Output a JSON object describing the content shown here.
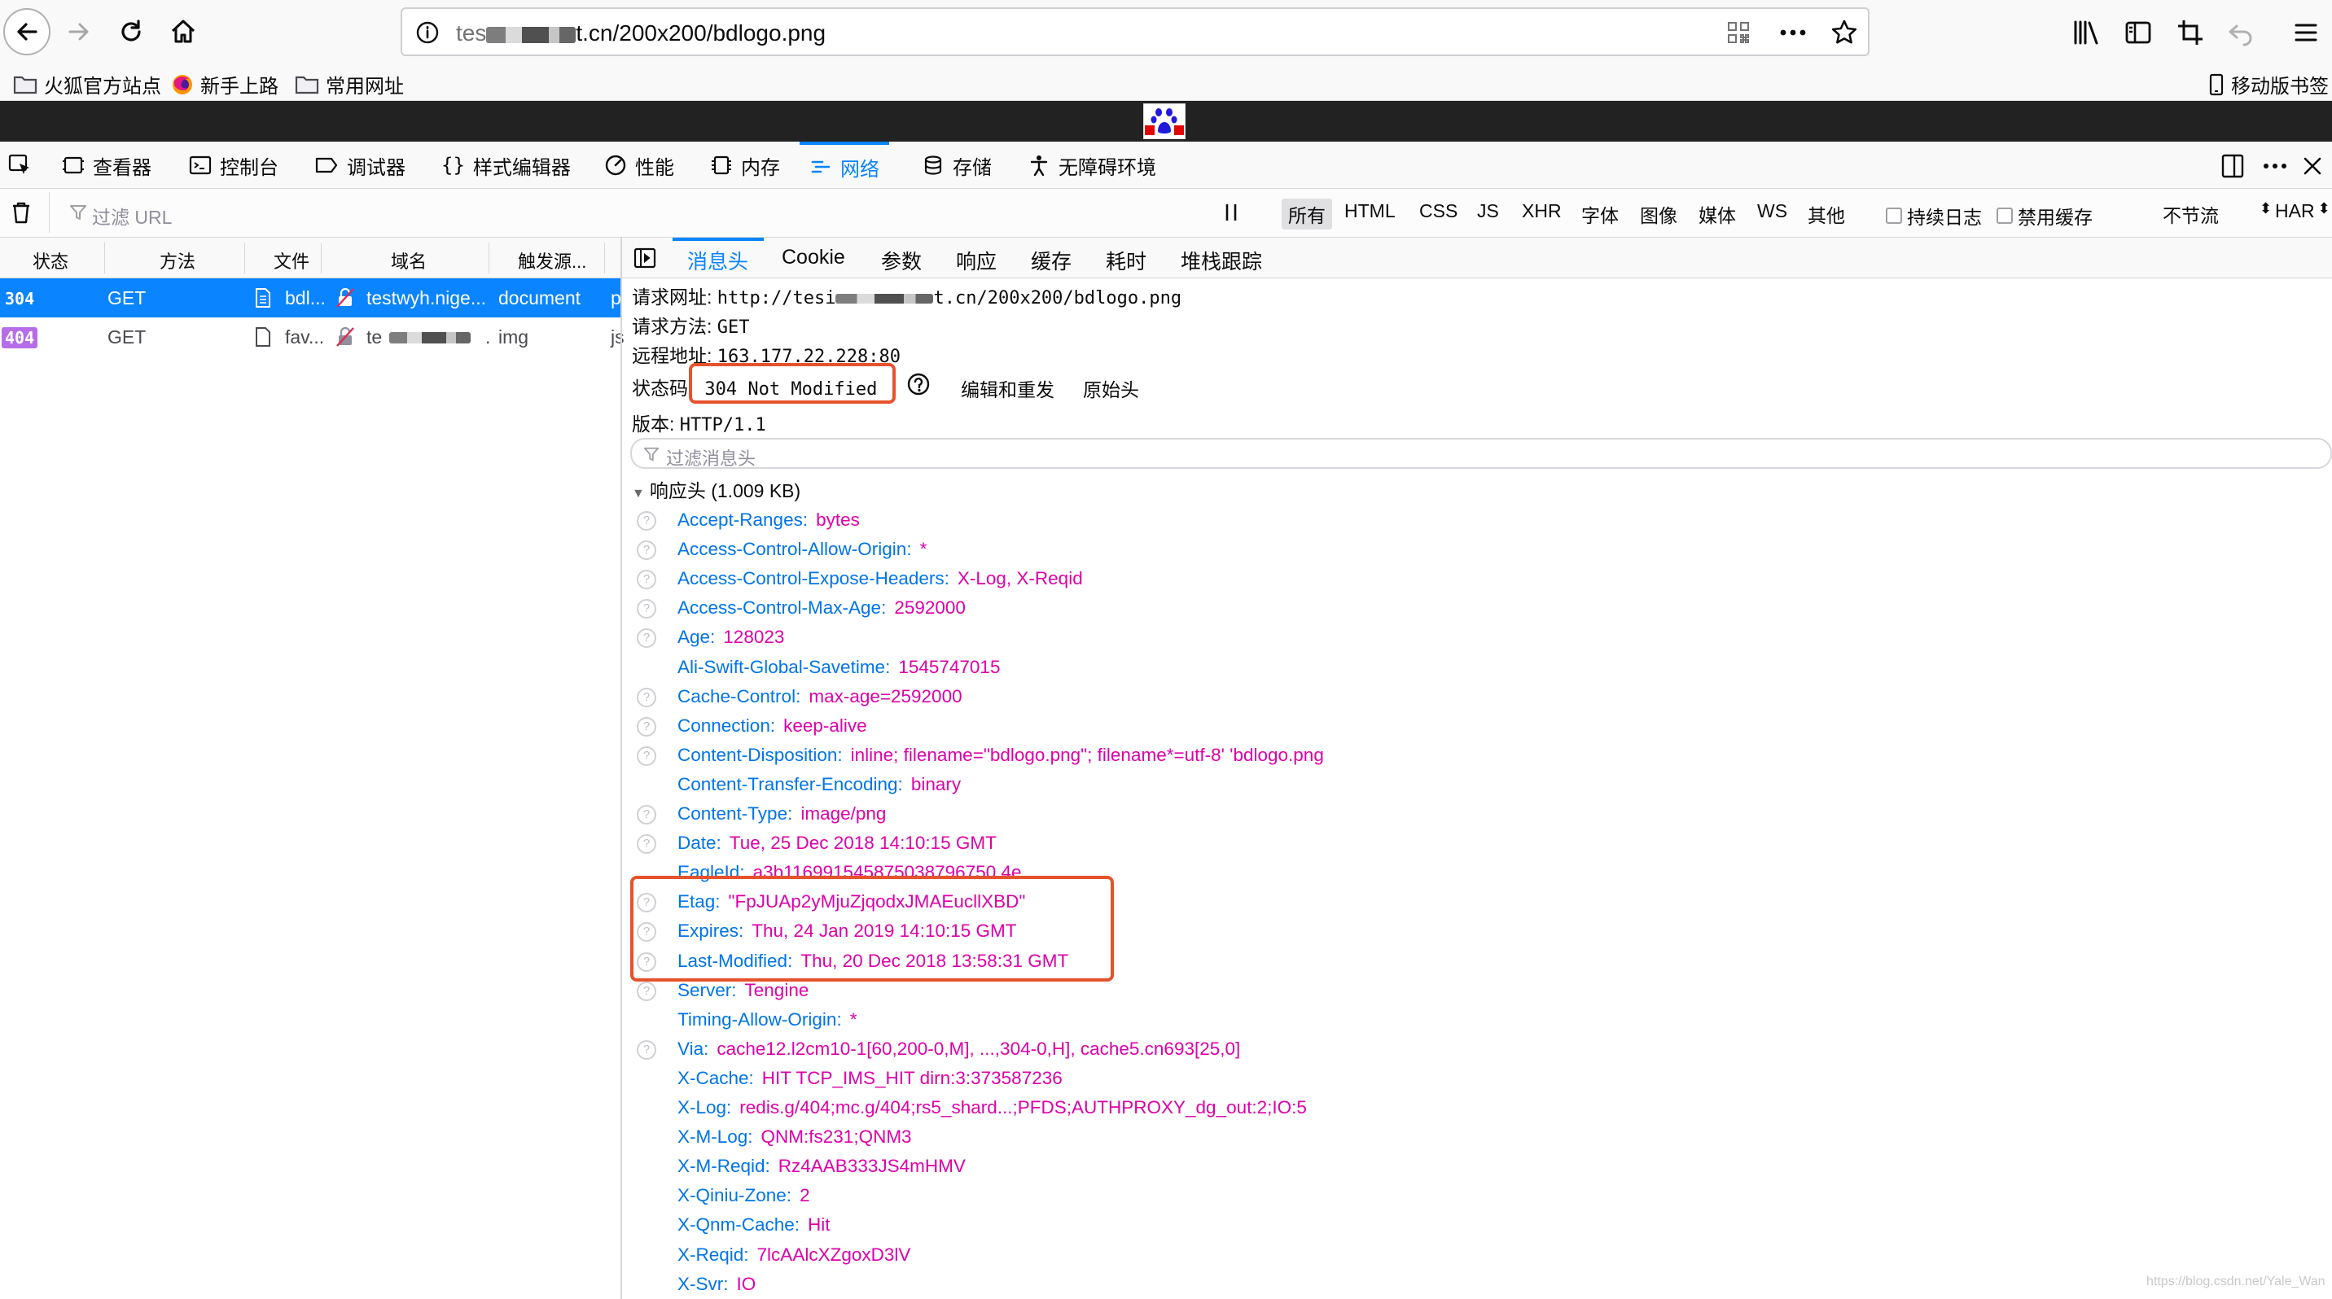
{
  "browser": {
    "url_prefix": "tes",
    "url_suffix": "t.cn/200x200/bdlogo.png",
    "bookmarks": [
      {
        "label": "火狐官方站点",
        "icon": "folder-icon"
      },
      {
        "label": "新手上路",
        "icon": "firefox-icon"
      },
      {
        "label": "常用网址",
        "icon": "folder-icon"
      }
    ],
    "mobile_bookmarks": "移动版书签"
  },
  "devtools": {
    "tabs": [
      "查看器",
      "控制台",
      "调试器",
      "样式编辑器",
      "性能",
      "内存",
      "网络",
      "存储",
      "无障碍环境"
    ],
    "active_tab": "网络"
  },
  "filter": {
    "placeholder": "过滤 URL",
    "types": [
      "所有",
      "HTML",
      "CSS",
      "JS",
      "XHR",
      "字体",
      "图像",
      "媒体",
      "WS",
      "其他"
    ],
    "persist_logs": "持续日志",
    "disable_cache": "禁用缓存",
    "throttle": "不节流",
    "har": "HAR"
  },
  "request_list": {
    "columns": [
      "状态",
      "方法",
      "文件",
      "域名",
      "触发源..."
    ],
    "rows": [
      {
        "status": "304",
        "method": "GET",
        "file": "bdl...",
        "domain": "testwyh.nige...",
        "cause": "document",
        "extra": "p"
      },
      {
        "status": "404",
        "method": "GET",
        "file": "fav...",
        "domain": "te",
        "cause": "img",
        "extra": "js"
      }
    ]
  },
  "panel": {
    "tabs": [
      "消息头",
      "Cookie",
      "参数",
      "响应",
      "缓存",
      "耗时",
      "堆栈跟踪"
    ],
    "active_tab": "消息头",
    "summary": {
      "url_label": "请求网址:",
      "url_prefix": "http://tesi",
      "url_suffix": "t.cn/200x200/bdlogo.png",
      "method_label": "请求方法:",
      "method": "GET",
      "remote_label": "远程地址:",
      "remote": "163.177.22.228:80",
      "status_label": "状态码",
      "status": "304 Not Modified",
      "edit_resend": "编辑和重发",
      "raw_headers": "原始头",
      "version_label": "版本:",
      "version": "HTTP/1.1"
    },
    "filter_placeholder": "过滤消息头",
    "response_section": "响应头 (1.009 KB)",
    "headers": [
      {
        "name": "Accept-Ranges:",
        "value": "bytes",
        "help": true
      },
      {
        "name": "Access-Control-Allow-Origin:",
        "value": "*",
        "help": true
      },
      {
        "name": "Access-Control-Expose-Headers:",
        "value": "X-Log, X-Reqid",
        "help": true
      },
      {
        "name": "Access-Control-Max-Age:",
        "value": "2592000",
        "help": true
      },
      {
        "name": "Age:",
        "value": "128023",
        "help": true
      },
      {
        "name": "Ali-Swift-Global-Savetime:",
        "value": "1545747015",
        "help": false
      },
      {
        "name": "Cache-Control:",
        "value": "max-age=2592000",
        "help": true
      },
      {
        "name": "Connection:",
        "value": "keep-alive",
        "help": true
      },
      {
        "name": "Content-Disposition:",
        "value": "inline; filename=\"bdlogo.png\"; filename*=utf-8' 'bdlogo.png",
        "help": true
      },
      {
        "name": "Content-Transfer-Encoding:",
        "value": "binary",
        "help": false
      },
      {
        "name": "Content-Type:",
        "value": "image/png",
        "help": true
      },
      {
        "name": "Date:",
        "value": "Tue, 25 Dec 2018 14:10:15 GMT",
        "help": true
      },
      {
        "name": "EagleId:",
        "value": "a3b116991545875038796750 4e",
        "help": false
      },
      {
        "name": "Etag:",
        "value": "\"FpJUAp2yMjuZjqodxJMAEucllXBD\"",
        "help": true
      },
      {
        "name": "Expires:",
        "value": "Thu, 24 Jan 2019 14:10:15 GMT",
        "help": true
      },
      {
        "name": "Last-Modified:",
        "value": "Thu, 20 Dec 2018 13:58:31 GMT",
        "help": true
      },
      {
        "name": "Server:",
        "value": "Tengine",
        "help": true
      },
      {
        "name": "Timing-Allow-Origin:",
        "value": "*",
        "help": false
      },
      {
        "name": "Via:",
        "value": "cache12.l2cm10-1[60,200-0,M], ...,304-0,H], cache5.cn693[25,0]",
        "help": true
      },
      {
        "name": "X-Cache:",
        "value": "HIT TCP_IMS_HIT dirn:3:373587236",
        "help": false
      },
      {
        "name": "X-Log:",
        "value": "redis.g/404;mc.g/404;rs5_shard...;PFDS;AUTHPROXY_dg_out:2;IO:5",
        "help": false
      },
      {
        "name": "X-M-Log:",
        "value": "QNM:fs231;QNM3",
        "help": false
      },
      {
        "name": "X-M-Reqid:",
        "value": "Rz4AAB333JS4mHMV",
        "help": false
      },
      {
        "name": "X-Qiniu-Zone:",
        "value": "2",
        "help": false
      },
      {
        "name": "X-Qnm-Cache:",
        "value": "Hit",
        "help": false
      },
      {
        "name": "X-Reqid:",
        "value": "7lcAAlcXZgoxD3lV",
        "help": false
      },
      {
        "name": "X-Svr:",
        "value": "IO",
        "help": false
      }
    ]
  },
  "watermark": "https://blog.csdn.net/Yale_Wan",
  "colors": {
    "accent": "#0a84ff",
    "header_name": "#0074e8",
    "header_value": "#dd00a9",
    "highlight_box": "#e6522c",
    "status_404": "#b66ee8"
  }
}
